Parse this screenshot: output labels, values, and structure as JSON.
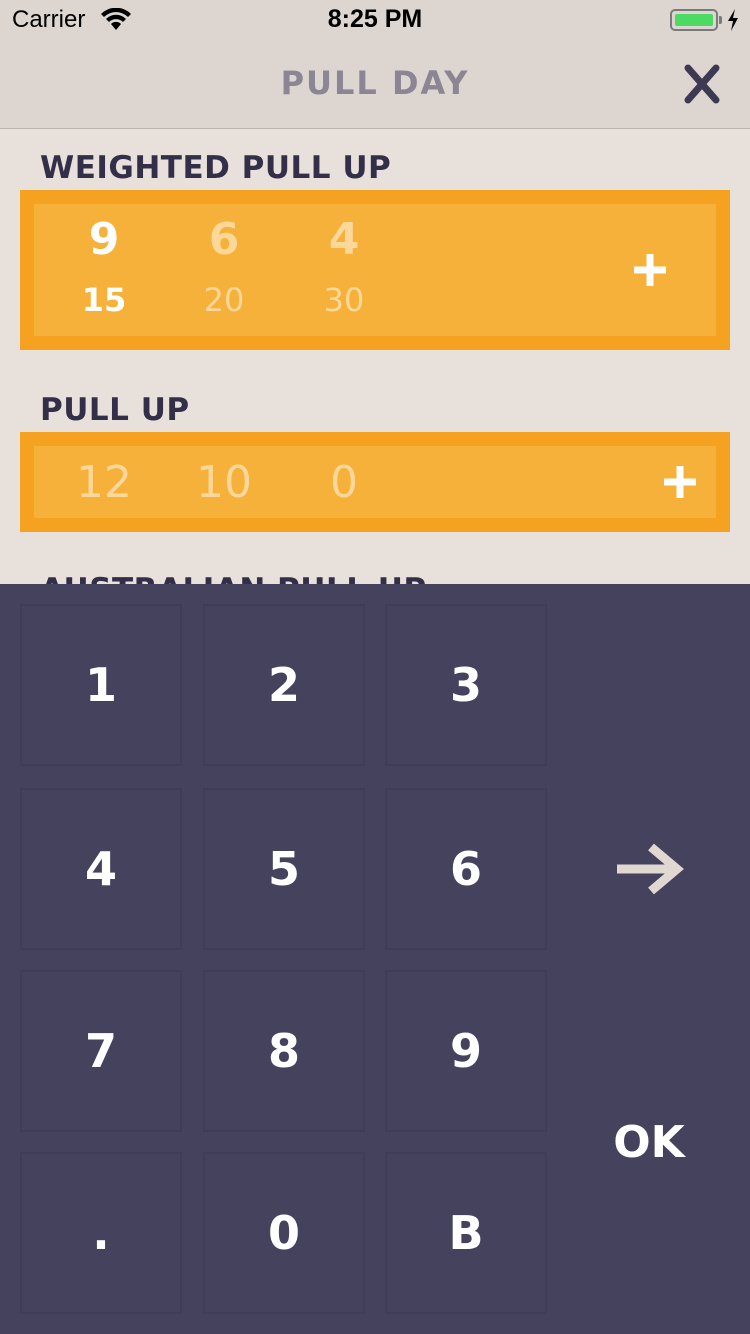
{
  "status_bar": {
    "carrier": "Carrier",
    "time": "8:25 PM"
  },
  "nav": {
    "title": "PULL DAY",
    "close_icon": "close-icon"
  },
  "exercises": [
    {
      "name": "WEIGHTED PULL UP",
      "sets": [
        {
          "reps": "9",
          "weight": "15",
          "active": true
        },
        {
          "reps": "6",
          "weight": "20",
          "active": false
        },
        {
          "reps": "4",
          "weight": "30",
          "active": false
        }
      ],
      "add_icon": "plus-icon"
    },
    {
      "name": "PULL UP",
      "sets": [
        {
          "reps": "12"
        },
        {
          "reps": "10"
        },
        {
          "reps": "0"
        }
      ],
      "add_icon": "plus-icon"
    },
    {
      "name": "AUSTRALIAN PULL UP"
    }
  ],
  "keypad": {
    "keys": [
      "1",
      "2",
      "3",
      "4",
      "5",
      "6",
      "7",
      "8",
      "9",
      ".",
      "0",
      "B"
    ],
    "next_icon": "arrow-right-icon",
    "ok_label": "OK"
  },
  "colors": {
    "card_outer": "#f6a221",
    "card_inner": "#f6b13a",
    "keypad_bg": "#45425e",
    "title_text": "#332f49",
    "background": "#e8e0da"
  }
}
